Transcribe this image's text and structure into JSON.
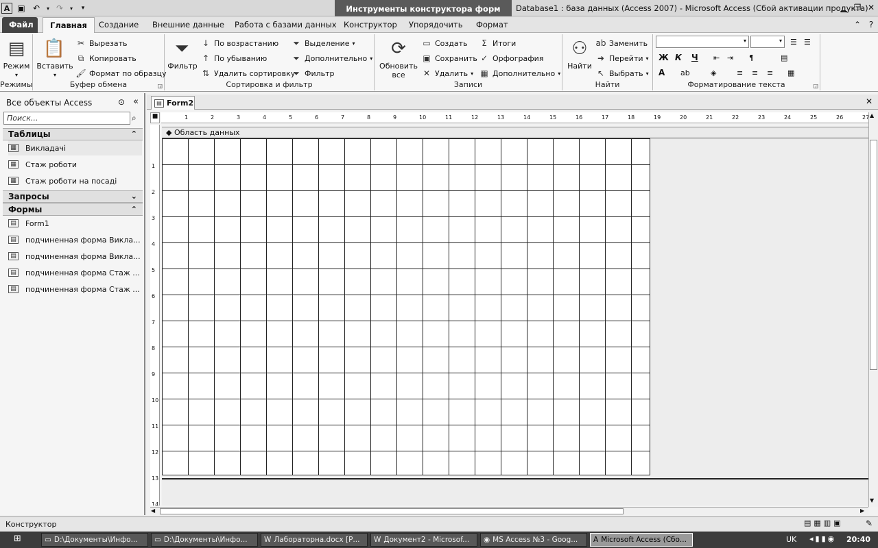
{
  "title_bar": {
    "context_label": "Инструменты конструктора форм",
    "window_title": "Database1 : база данных (Access 2007)  -  Microsoft Access (Сбой активации продукта)"
  },
  "tabs": [
    "Файл",
    "Главная",
    "Создание",
    "Внешние данные",
    "Работа с базами данных",
    "Конструктор",
    "Упорядочить",
    "Формат"
  ],
  "ribbon": {
    "views": {
      "label": "Режимы",
      "view_btn": "Режим"
    },
    "clipboard": {
      "label": "Буфер обмена",
      "paste": "Вставить",
      "cut": "Вырезать",
      "copy": "Копировать",
      "format_painter": "Формат по образцу"
    },
    "sort": {
      "label": "Сортировка и фильтр",
      "filter": "Фильтр",
      "asc": "По возрастанию",
      "desc": "По убыванию",
      "clear": "Удалить сортировку",
      "selection": "Выделение",
      "advanced": "Дополнительно",
      "toggle": "Фильтр"
    },
    "records": {
      "label": "Записи",
      "refresh": "Обновить",
      "refresh2": "все",
      "new": "Создать",
      "save": "Сохранить",
      "delete": "Удалить",
      "totals": "Итоги",
      "spelling": "Орфография",
      "more": "Дополнительно"
    },
    "find": {
      "label": "Найти",
      "find": "Найти",
      "replace": "Заменить",
      "goto": "Перейти",
      "select": "Выбрать"
    },
    "text_format": {
      "label": "Форматирование текста",
      "bold": "Ж",
      "italic": "К",
      "underline": "Ч"
    }
  },
  "nav": {
    "header": "Все объекты Access",
    "search_placeholder": "Поиск...",
    "sections": [
      {
        "title": "Таблицы",
        "items": [
          "Викладачі",
          "Стаж роботи",
          "Стаж роботи на посаді"
        ]
      },
      {
        "title": "Запросы",
        "items": []
      },
      {
        "title": "Формы",
        "items": [
          "Form1",
          "подчиненная форма Викла...",
          "подчиненная форма Викла...",
          "подчиненная форма Стаж ...",
          "подчиненная форма Стаж ..."
        ]
      }
    ]
  },
  "document": {
    "tab": "Form2",
    "section": "Область данных"
  },
  "status": "Конструктор",
  "taskbar": {
    "items": [
      "D:\\Документы\\Инфо...",
      "D:\\Документы\\Инфо...",
      "Лабораторна.docx [Р...",
      "Документ2 - Microsof...",
      "MS Access №3 - Goog...",
      "Microsoft Access (Сбо..."
    ],
    "lang": "UK",
    "clock": "20:40"
  }
}
